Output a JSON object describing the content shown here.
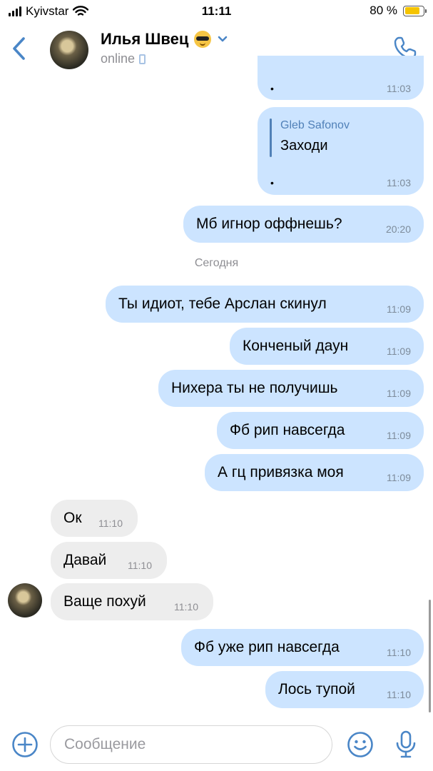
{
  "status_bar": {
    "carrier": "Kyivstar",
    "time": "11:11",
    "battery": "80 %",
    "battery_level": 0.8
  },
  "header": {
    "contact_name": "Илья Швец",
    "status": "online",
    "icons": [
      "back-chevron-icon",
      "avatar",
      "sunglasses-emoji-icon",
      "chevron-down-icon",
      "mobile-device-icon",
      "phone-icon"
    ]
  },
  "messages": {
    "m0": {
      "text": "•",
      "time": "11:03"
    },
    "m1": {
      "reply_author": "Gleb Safonov",
      "reply_text": "Заходи",
      "text": "•",
      "time": "11:03"
    },
    "m2": {
      "text": "Мб игнор оффнешь?",
      "time": "20:20"
    },
    "date_separator": "Сегодня",
    "m3": {
      "text": "Ты идиот, тебе Арслан скинул",
      "time": "11:09"
    },
    "m4": {
      "text": "Конченый даун",
      "time": "11:09"
    },
    "m5": {
      "text": "Нихера ты не получишь",
      "time": "11:09"
    },
    "m6": {
      "text": "Фб рип навсегда",
      "time": "11:09"
    },
    "m7": {
      "text": "А гц привязка моя",
      "time": "11:09"
    },
    "m8": {
      "text": "Ок",
      "time": "11:10"
    },
    "m9": {
      "text": "Давай",
      "time": "11:10"
    },
    "m10": {
      "text": "Ваще похуй",
      "time": "11:10"
    },
    "m11": {
      "text": "Фб уже рип навсегда",
      "time": "11:10"
    },
    "m12": {
      "text": "Лось тупой",
      "time": "11:10"
    }
  },
  "composer": {
    "placeholder": "Сообщение",
    "value": "",
    "icons": [
      "plus-icon",
      "smile-icon",
      "microphone-icon"
    ]
  },
  "colors": {
    "accent": "#5181b8",
    "outgoing_bubble": "#cce4ff",
    "incoming_bubble": "#ededed",
    "battery_fill": "#f5c400"
  }
}
